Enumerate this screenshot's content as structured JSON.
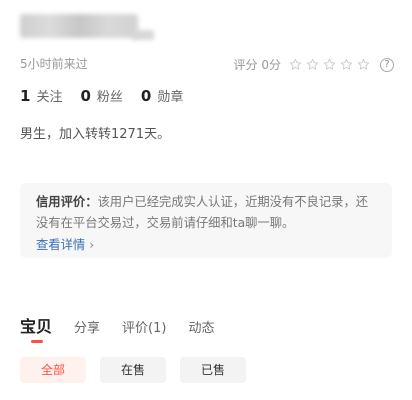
{
  "profile": {
    "last_seen": "5小时前来过",
    "rating_label": "评分 0分",
    "rating_value": 0,
    "rating_max": 5,
    "help_icon": "help-circle-icon",
    "stats": [
      {
        "num": "1",
        "label": "关注"
      },
      {
        "num": "0",
        "label": "粉丝"
      },
      {
        "num": "0",
        "label": "勋章"
      }
    ],
    "bio": "男生，加入转转1271天。"
  },
  "credit": {
    "title": "信用评价：",
    "text": "该用户已经完成实人认证，近期没有不良记录，还没有在平台交易过，交易前请仔细和ta聊一聊。",
    "link": "查看详情",
    "chevron": "›"
  },
  "tabs": [
    "宝贝",
    "分享",
    "评价(1)",
    "动态"
  ],
  "filters": [
    "全部",
    "在售",
    "已售"
  ],
  "colors": {
    "accent": "#ff4e3f",
    "link": "#3b6fb6"
  }
}
